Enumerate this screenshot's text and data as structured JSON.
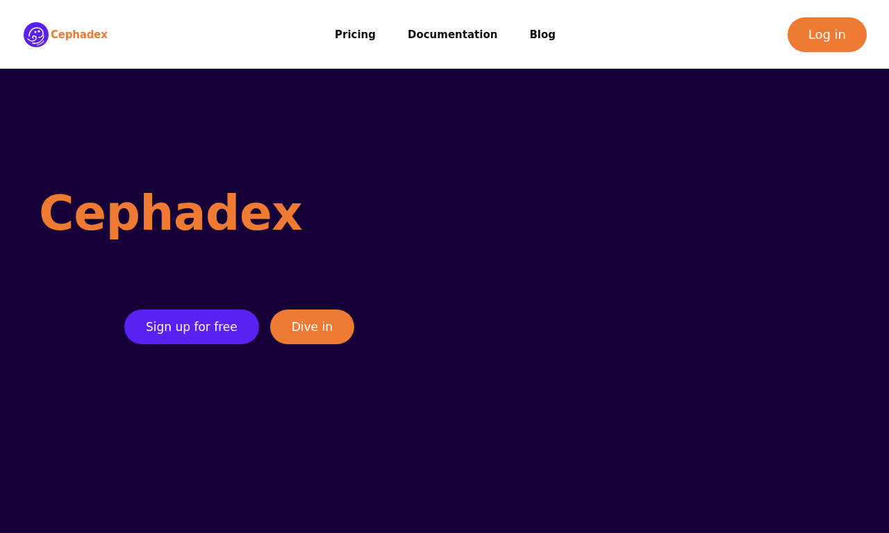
{
  "header": {
    "logo": {
      "text": "Cephadex"
    },
    "nav": [
      {
        "label": "Pricing"
      },
      {
        "label": "Documentation"
      },
      {
        "label": "Blog"
      }
    ],
    "login_button": "Log in"
  },
  "hero": {
    "title": "Cephadex",
    "buttons": [
      {
        "label": "Sign up for free",
        "kind": "primary"
      },
      {
        "label": "Dive in",
        "kind": "secondary"
      }
    ]
  }
}
